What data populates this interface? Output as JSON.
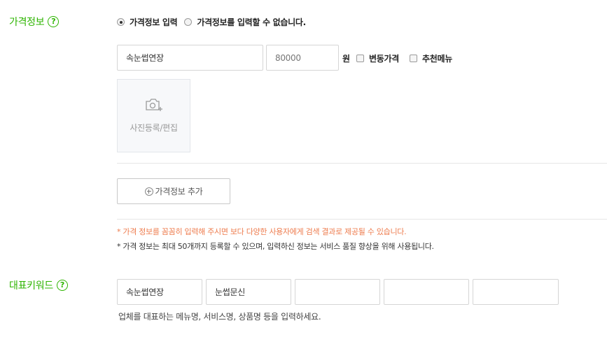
{
  "price_section": {
    "label": "가격정보",
    "radio_options": [
      {
        "label": "가격정보 입력",
        "selected": true
      },
      {
        "label": "가격정보를 입력할 수 없습니다.",
        "selected": false
      }
    ],
    "menu_name_value": "속눈썹연장",
    "price_placeholder": "80000",
    "currency_unit": "원",
    "checkbox_variable_price": "변동가격",
    "checkbox_recommended_menu": "추천메뉴",
    "photo_label": "사진등록/편집",
    "add_button_label": "가격정보 추가",
    "note_warning": "* 가격 정보를 꼼꼼히 입력해 주시면 보다 다양한 사용자에게 검색 결과로 제공될 수 있습니다.",
    "note_info": "* 가격 정보는 최대 50개까지 등록할 수 있으며, 입력하신 정보는 서비스 품질 향상을 위해 사용됩니다."
  },
  "keyword_section": {
    "label": "대표키워드",
    "keywords": [
      "속눈썹연장",
      "눈썹문신",
      "",
      "",
      ""
    ],
    "hint": "업체를 대표하는 메뉴명, 서비스명, 상품명 등을 입력하세요."
  },
  "colors": {
    "accent": "#2db400",
    "warning": "#ee7c4e"
  },
  "icons": {
    "help": "question-circle-icon",
    "camera": "camera-plus-icon",
    "add": "plus-circle-icon"
  }
}
